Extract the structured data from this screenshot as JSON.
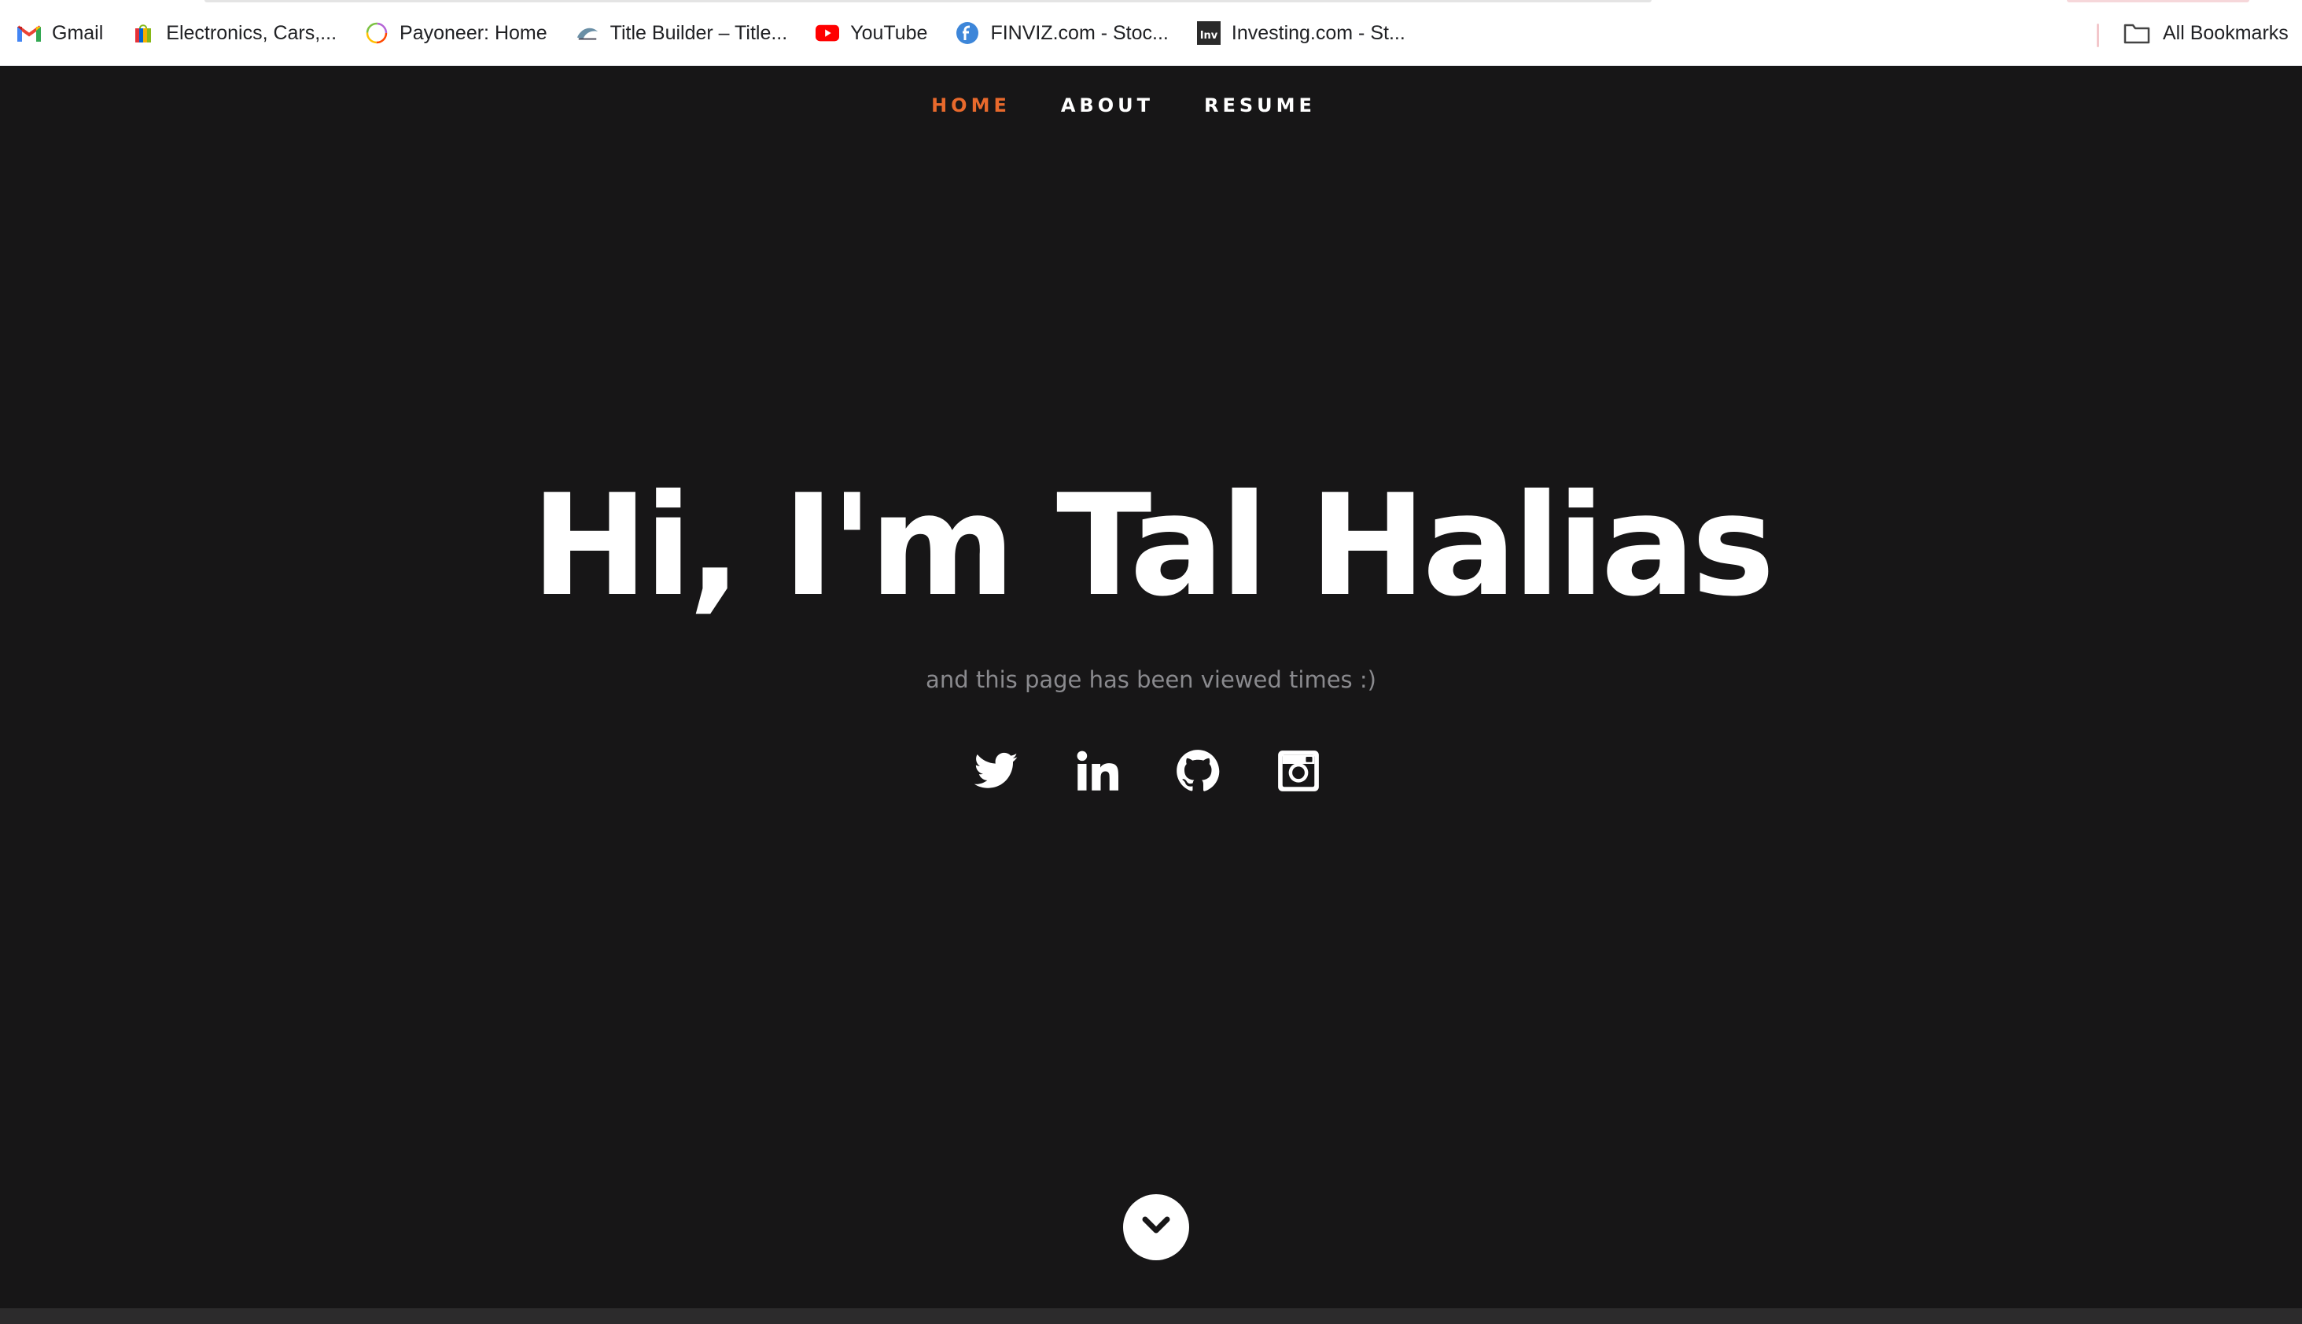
{
  "bookmarks": [
    {
      "label": "Gmail",
      "icon": "gmail-icon"
    },
    {
      "label": "Electronics, Cars,...",
      "icon": "ebay-bag-icon"
    },
    {
      "label": "Payoneer: Home",
      "icon": "payoneer-ring-icon"
    },
    {
      "label": "Title Builder – Title...",
      "icon": "title-builder-icon"
    },
    {
      "label": "YouTube",
      "icon": "youtube-icon"
    },
    {
      "label": "FINVIZ.com - Stoc...",
      "icon": "finviz-icon"
    },
    {
      "label": "Investing.com - St...",
      "icon": "investing-icon"
    }
  ],
  "all_bookmarks": {
    "label": "All Bookmarks",
    "icon": "folder-icon"
  },
  "nav": {
    "items": [
      "HOME",
      "ABOUT",
      "RESUME"
    ],
    "active": "HOME"
  },
  "hero": {
    "title": "Hi, I'm Tal Halias",
    "subtitle": "and this page has been viewed times :)"
  },
  "social": [
    "twitter-icon",
    "linkedin-icon",
    "github-icon",
    "instagram-icon"
  ],
  "scroll": {
    "icon": "chevron-down-icon"
  },
  "colors": {
    "background": "#171617",
    "accent": "#e8692c",
    "text": "#ffffff",
    "muted": "#8a8a8e"
  }
}
